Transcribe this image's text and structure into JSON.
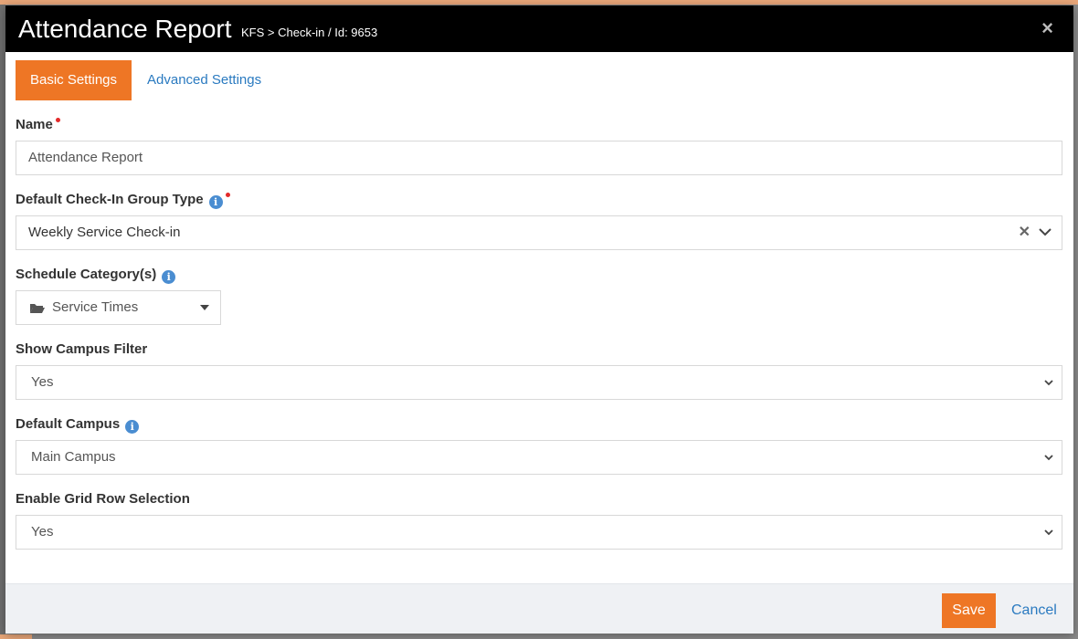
{
  "modal": {
    "title": "Attendance Report",
    "subtitle": "KFS > Check-in / Id: 9653",
    "close_label": "×"
  },
  "tabs": [
    {
      "label": "Basic Settings",
      "active": true
    },
    {
      "label": "Advanced Settings",
      "active": false
    }
  ],
  "fields": {
    "name": {
      "label": "Name",
      "value": "Attendance Report",
      "required": true
    },
    "group_type": {
      "label": "Default Check-In Group Type",
      "value": "Weekly Service Check-in",
      "required": true,
      "has_info": true
    },
    "schedule_category": {
      "label": "Schedule Category(s)",
      "value": "Service Times",
      "has_info": true
    },
    "show_campus_filter": {
      "label": "Show Campus Filter",
      "value": "Yes"
    },
    "default_campus": {
      "label": "Default Campus",
      "value": "Main Campus",
      "has_info": true
    },
    "grid_row_selection": {
      "label": "Enable Grid Row Selection",
      "value": "Yes"
    }
  },
  "footer": {
    "save_label": "Save",
    "cancel_label": "Cancel"
  },
  "icons": {
    "info": "info-circle-icon",
    "folder": "folder-open-icon",
    "clear": "clear-x-icon",
    "chevron": "chevron-down-icon"
  },
  "colors": {
    "accent": "#ee7625",
    "link": "#2a7ac0",
    "header_bg": "#000000",
    "required": "#e32a2a",
    "info": "#4a8dd1"
  }
}
